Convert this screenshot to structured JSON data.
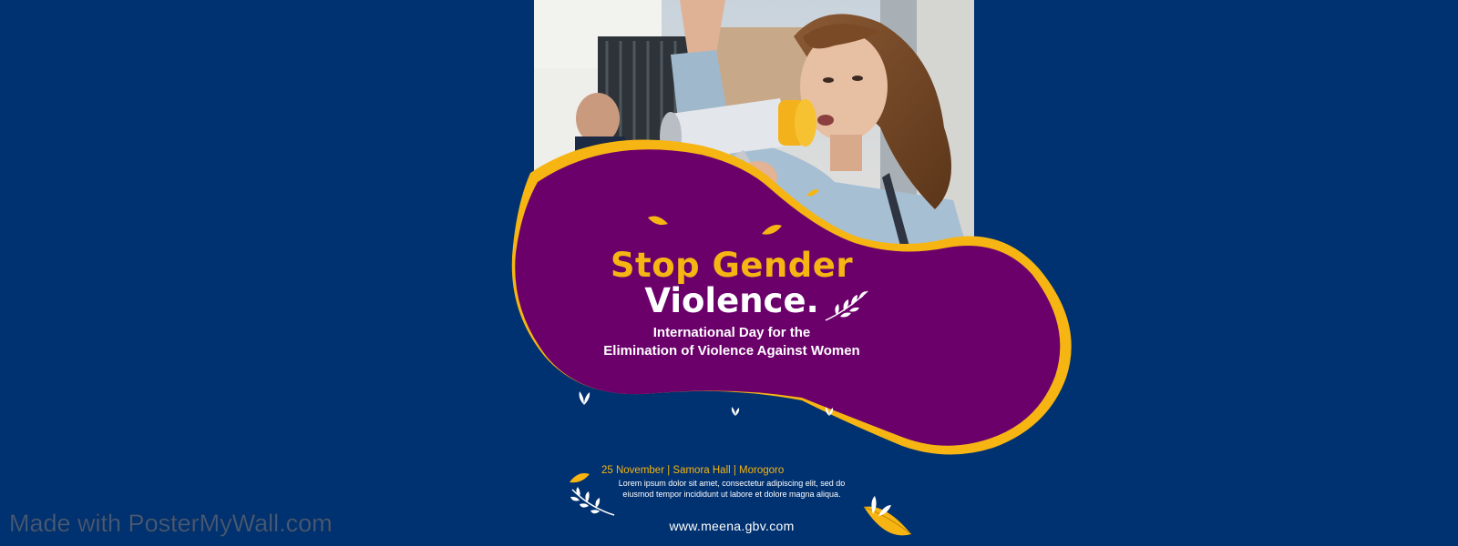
{
  "poster": {
    "title_line1": "Stop Gender",
    "title_line2": "Violence.",
    "subtitle_line1": "International Day for the",
    "subtitle_line2": "Elimination of Violence Against Women",
    "event_info": "25 November | Samora Hall  | Morogoro",
    "description_line1": "Lorem ipsum dolor sit amet, consectetur adipiscing elit, sed do",
    "description_line2": "eiusmod tempor incididunt ut labore et dolore magna aliqua.",
    "website": "www.meena.gbv.com",
    "photo_subject": "woman-with-megaphone-photo"
  },
  "watermark": "Made with PosterMyWall.com",
  "colors": {
    "background": "#003170",
    "blob_purple": "#6b006b",
    "accent_yellow": "#f6b512",
    "text_white": "#ffffff"
  }
}
